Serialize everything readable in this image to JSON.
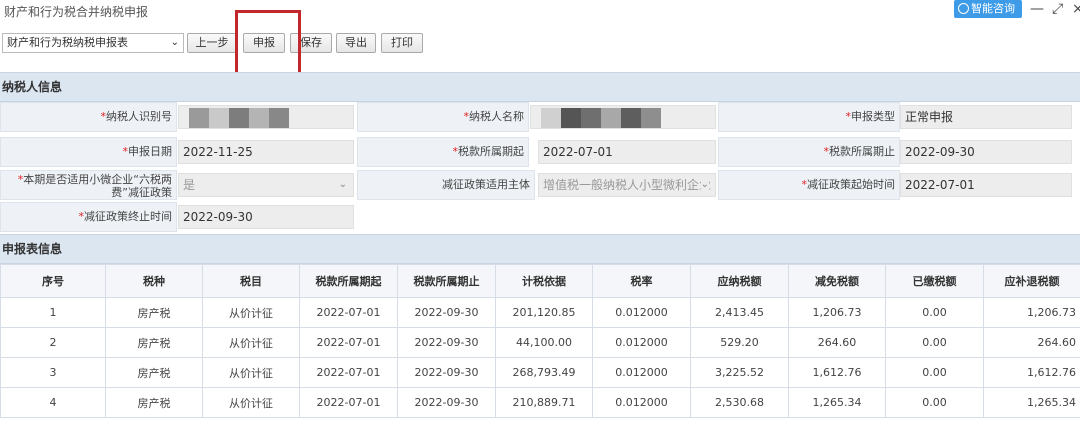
{
  "window": {
    "title": "财产和行为税合并纳税申报",
    "help_label": "智能咨询",
    "minimize": "—",
    "restore": "⤢",
    "close": "×"
  },
  "toolbar": {
    "report_select": "财产和行为税纳税申报表",
    "prev_label": "上一步",
    "declare_label": "申报",
    "save_label": "保存",
    "export_label": "导出",
    "print_label": "打印"
  },
  "taxpayer": {
    "section_title": "纳税人信息",
    "id_label": "纳税人识别号",
    "name_label": "纳税人名称",
    "report_type_label": "申报类型",
    "report_type": "正常申报",
    "report_date_label": "申报日期",
    "report_date": "2022-11-25",
    "period_start_label": "税款所属期起",
    "period_start": "2022-07-01",
    "period_end_label": "税款所属期止",
    "period_end": "2022-09-30",
    "small_biz_label_1": "本期是否适用小微企业“六税两",
    "small_biz_label_2": "费”减征政策",
    "small_biz_value": "是",
    "subject_label": "减征政策适用主体",
    "subject_value": "增值税一般纳税人小型微利企业",
    "relief_start_label": "减征政策起始时间",
    "relief_start": "2022-07-01",
    "relief_end_label": "减征政策终止时间",
    "relief_end": "2022-09-30"
  },
  "declaration": {
    "section_title": "申报表信息",
    "columns": [
      "序号",
      "税种",
      "税目",
      "税款所属期起",
      "税款所属期止",
      "计税依据",
      "税率",
      "应纳税额",
      "减免税额",
      "已缴税额",
      "应补退税额"
    ],
    "rows": [
      [
        "1",
        "房产税",
        "从价计征",
        "2022-07-01",
        "2022-09-30",
        "201,120.85",
        "0.012000",
        "2,413.45",
        "1,206.73",
        "0.00",
        "1,206.73"
      ],
      [
        "2",
        "房产税",
        "从价计征",
        "2022-07-01",
        "2022-09-30",
        "44,100.00",
        "0.012000",
        "529.20",
        "264.60",
        "0.00",
        "264.60"
      ],
      [
        "3",
        "房产税",
        "从价计征",
        "2022-07-01",
        "2022-09-30",
        "268,793.49",
        "0.012000",
        "3,225.52",
        "1,612.76",
        "0.00",
        "1,612.76"
      ],
      [
        "4",
        "房产税",
        "从价计征",
        "2022-07-01",
        "2022-09-30",
        "210,889.71",
        "0.012000",
        "2,530.68",
        "1,265.34",
        "0.00",
        "1,265.34"
      ]
    ]
  }
}
